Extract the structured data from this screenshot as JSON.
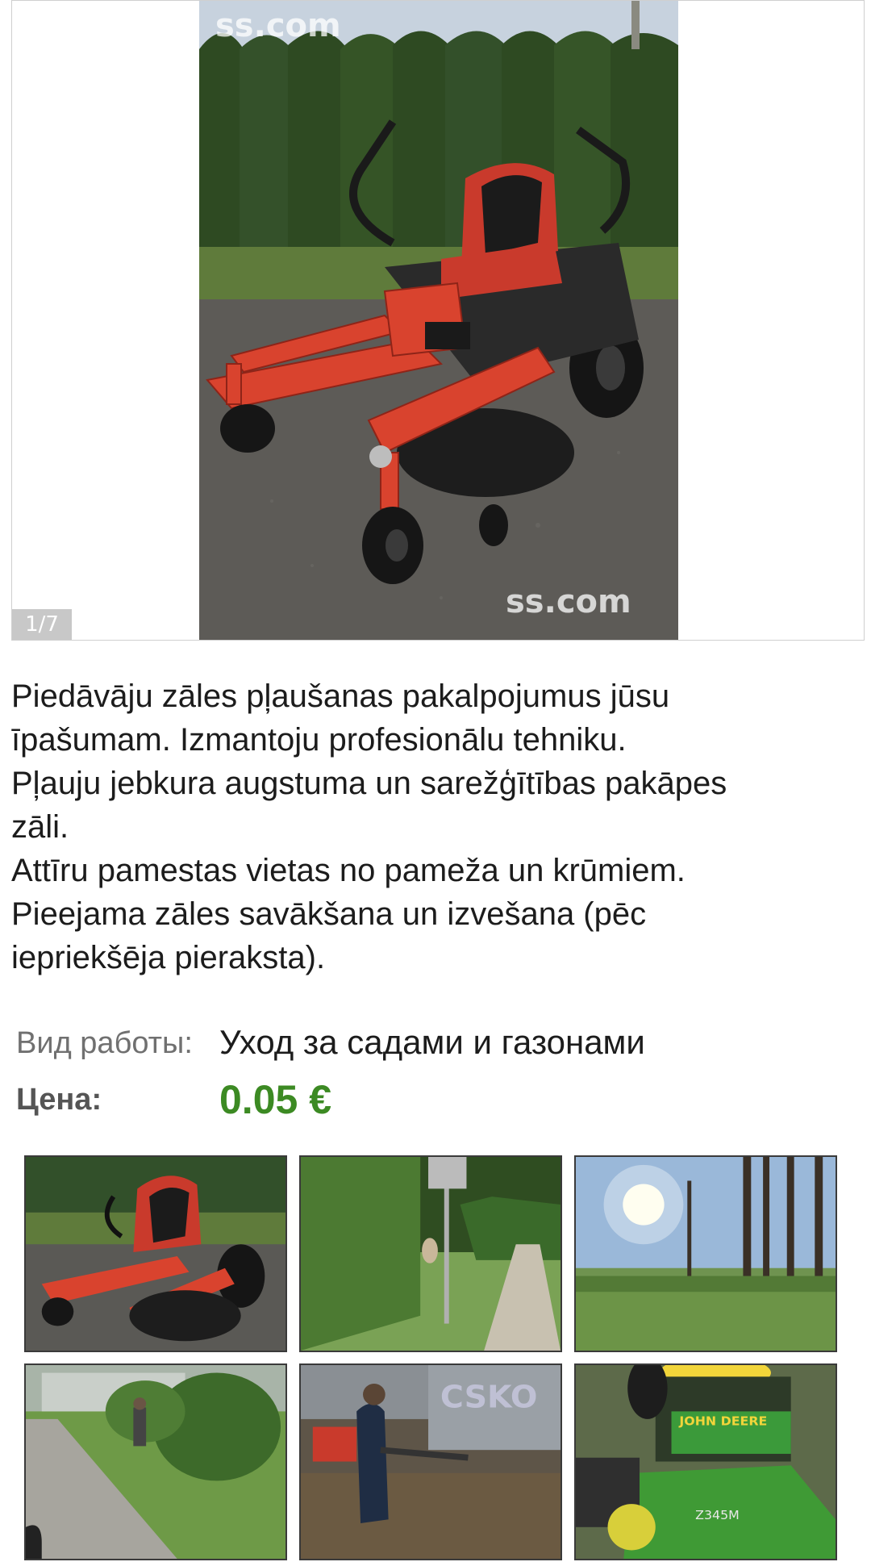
{
  "gallery": {
    "counter": "1/7",
    "watermark_top": "ss.com",
    "watermark_bottom": "ss.com",
    "current_index": 1,
    "total": 7
  },
  "description": {
    "lines": [
      "Piedāvāju zāles pļaušanas pakalpojumus jūsu",
      "īpašumam. Izmantoju profesionālu tehniku.",
      "Pļauju jebkura augstuma un sarežģītības pakāpes",
      "zāli.",
      "Attīru pamestas vietas no pameža un krūmiem.",
      "Pieejama zāles savākšana un izvešana (pēc",
      "iepriekšēja pieraksta)."
    ]
  },
  "fields": {
    "work_type_label": "Вид работы:",
    "work_type_value": "Уход за садами и газонами",
    "price_label": "Цена:",
    "price_value": "0.05 €"
  },
  "thumbnails": [
    {
      "name": "red-mower"
    },
    {
      "name": "hedge-path"
    },
    {
      "name": "sunny-field"
    },
    {
      "name": "person-trimming"
    },
    {
      "name": "leaf-blower"
    },
    {
      "name": "john-deere-mower",
      "text": "JOHN DEERE",
      "model": "Z345M"
    }
  ],
  "colors": {
    "price": "#3c8a23",
    "label": "#707070",
    "mower_red": "#d9432e"
  }
}
